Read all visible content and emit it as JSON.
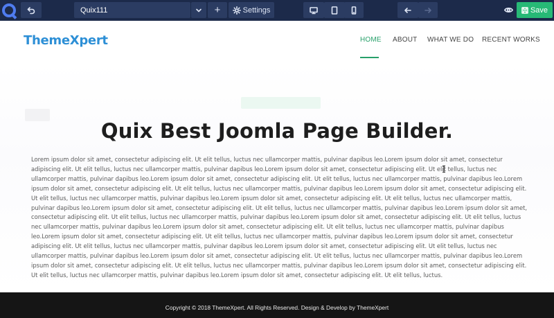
{
  "toolbar": {
    "logo_icon": "quix-logo-icon",
    "page_name": "Quix111",
    "settings_label": "Settings",
    "add_label": "+",
    "save_label": "Save",
    "save_color": "#27b976",
    "bar_color": "#1c2a4a"
  },
  "site": {
    "logo_text": "ThemeXpert",
    "logo_color": "#2d8fd6",
    "nav": [
      {
        "label": "HOME",
        "active": true
      },
      {
        "label": "ABOUT",
        "active": false
      },
      {
        "label": "WHAT WE DO",
        "active": false
      },
      {
        "label": "RECENT WORKS",
        "active": false
      }
    ],
    "accent_color": "#27a06a"
  },
  "hero": {
    "title": "Quix Best Joomla Page Builder.",
    "body": "Lorem ipsum dolor sit amet, consectetur adipiscing elit. Ut elit tellus, luctus nec ullamcorper mattis, pulvinar dapibus leo.Lorem ipsum dolor sit amet, consectetur adipiscing elit. Ut elit tellus, luctus nec ullamcorper mattis, pulvinar dapibus leo.Lorem ipsum dolor sit amet, consectetur adipiscing elit. Ut elit tellus, luctus nec ullamcorper mattis, pulvinar dapibus leo.Lorem ipsum dolor sit amet, consectetur adipiscing elit. Ut elit tellus, luctus nec ullamcorper mattis, pulvinar dapibus leo.Lorem ipsum dolor sit amet, consectetur adipiscing elit. Ut elit tellus, luctus nec ullamcorper mattis, pulvinar dapibus leo.Lorem ipsum dolor sit amet, consectetur adipiscing elit. Ut elit tellus, luctus nec ullamcorper mattis, pulvinar dapibus leo.Lorem ipsum dolor sit amet, consectetur adipiscing elit. Ut elit tellus, luctus nec ullamcorper mattis, pulvinar dapibus leo.Lorem ipsum dolor sit amet, consectetur adipiscing elit. Ut elit tellus, luctus nec ullamcorper mattis, pulvinar dapibus leo.Lorem ipsum dolor sit amet, consectetur adipiscing elit. Ut elit tellus, luctus nec ullamcorper mattis, pulvinar dapibus leo.Lorem ipsum dolor sit amet, consectetur adipiscing elit. Ut elit tellus, luctus nec ullamcorper mattis, pulvinar dapibus leo.Lorem ipsum dolor sit amet, consectetur adipiscing elit. Ut elit tellus, luctus nec ullamcorper mattis, pulvinar dapibus leo.Lorem ipsum dolor sit amet, consectetur adipiscing elit. Ut elit tellus, luctus nec ullamcorper mattis, pulvinar dapibus leo.Lorem ipsum dolor sit amet, consectetur adipiscing elit. Ut elit tellus, luctus nec ullamcorper mattis, pulvinar dapibus leo.Lorem ipsum dolor sit amet, consectetur adipiscing elit. Ut elit tellus, luctus nec ullamcorper mattis, pulvinar dapibus leo.Lorem ipsum dolor sit amet, consectetur adipiscing elit. Ut elit tellus, luctus nec ullamcorper mattis, pulvinar dapibus leo.Lorem ipsum dolor sit amet, consectetur adipiscing elit. Ut elit tellus, luctus nec ullamcorper mattis, pulvinar dapibus leo.Lorem ipsum dolor sit amet, consectetur adipiscing elit. Ut elit tellus, luctus nec ullamcorper mattis, pulvinar dapibus leo.Lorem ipsum dolor sit amet, consectetur adipiscing elit. Ut elit tellus, luctus."
  },
  "footer": {
    "text": "Copyright © 2018 ThemeXpert. All Rights Reserved. Design & Develop by ThemeXpert",
    "background": "#151515"
  }
}
